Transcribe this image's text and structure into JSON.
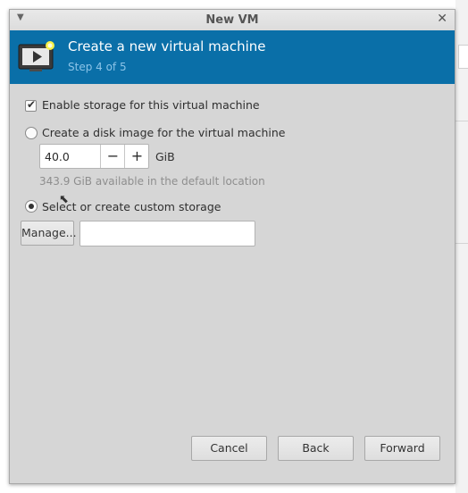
{
  "window": {
    "title": "New VM"
  },
  "header": {
    "title": "Create a new virtual machine",
    "step": "Step 4 of 5"
  },
  "storage": {
    "enable_label": "Enable storage for this virtual machine",
    "enable_checked": true,
    "create_disk_label": "Create a disk image for the virtual machine",
    "disk_size_value": "40.0",
    "disk_unit": "GiB",
    "available_text": "343.9 GiB available in the default location",
    "custom_label": "Select or create custom storage",
    "custom_selected": true,
    "manage_label": "Manage...",
    "custom_path_value": ""
  },
  "footer": {
    "cancel_label": "Cancel",
    "back_label": "Back",
    "forward_label": "Forward"
  },
  "colors": {
    "header_bg": "#0a6fa8",
    "header_sub": "#8cc4e8",
    "window_bg": "#d6d6d6"
  }
}
